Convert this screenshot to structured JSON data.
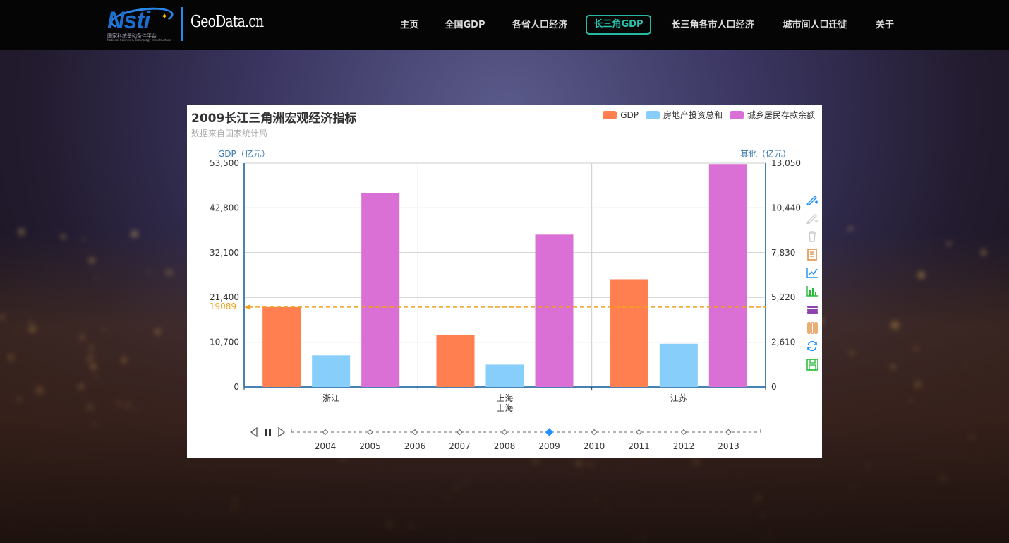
{
  "nav": {
    "logo_text": "Nsti",
    "logo_sub": "国家科技基础条件平台",
    "logo_sub_en": "National Science & Technology Infrastructure",
    "site_name": "GeoData.cn",
    "items": [
      {
        "label": "主页"
      },
      {
        "label": "全国GDP"
      },
      {
        "label": "各省人口经济"
      },
      {
        "label": "长三角GDP",
        "active": true
      },
      {
        "label": "长三角各市人口经济"
      },
      {
        "label": "城市间人口迁徙"
      },
      {
        "label": "关于"
      }
    ]
  },
  "chart": {
    "title": "2009长江三角洲宏观经济指标",
    "subtitle": "数据来自国家统计局"
  },
  "chart_data": {
    "type": "bar",
    "title": "2009长江三角洲宏观经济指标",
    "subtitle": "数据来自国家统计局",
    "categories": [
      "浙江",
      "上海",
      "江苏"
    ],
    "series": [
      {
        "name": "GDP",
        "axis": "left",
        "color": "#ff7f50",
        "values": [
          19089,
          12494,
          25741
        ]
      },
      {
        "name": "房地产投资总和",
        "axis": "right",
        "color": "#87cefa",
        "values": [
          1840,
          1300,
          2520
        ]
      },
      {
        "name": "城乡居民存款余额",
        "axis": "right",
        "color": "#da70d6",
        "values": [
          11290,
          8880,
          13000
        ]
      }
    ],
    "y_left": {
      "label": "GDP（亿元）",
      "ticks": [
        "0",
        "10,700",
        "21,400",
        "32,100",
        "42,800",
        "53,500"
      ],
      "min": 0,
      "max": 53500
    },
    "y_right": {
      "label": "其他（亿元）",
      "ticks": [
        "0",
        "2,610",
        "5,220",
        "7,830",
        "10,440",
        "13,050"
      ],
      "min": 0,
      "max": 13050
    },
    "markline": {
      "label": "19089",
      "value": 19089,
      "color": "#f0a020"
    },
    "xaxis_name": "上海",
    "grid": true,
    "legend_position": "top-right"
  },
  "timeline": {
    "years": [
      "2004",
      "2005",
      "2006",
      "2007",
      "2008",
      "2009",
      "2010",
      "2011",
      "2012",
      "2013"
    ],
    "current": "2009",
    "current_index": 5
  },
  "toolbox": {
    "icons": [
      "mark-pen-icon",
      "mark-undo-icon",
      "mark-clear-icon",
      "data-view-icon",
      "line-chart-icon",
      "bar-chart-icon",
      "stack-icon",
      "tiled-icon",
      "restore-icon",
      "save-image-icon"
    ]
  }
}
